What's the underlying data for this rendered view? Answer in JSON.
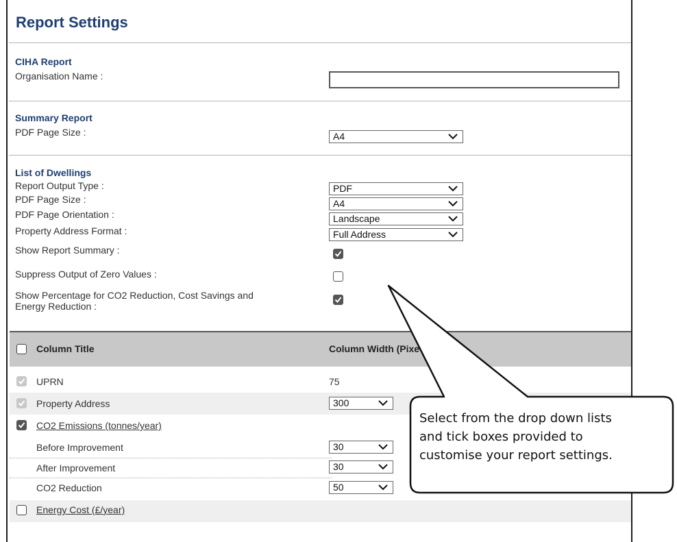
{
  "page_title": "Report Settings",
  "ciha": {
    "heading": "CIHA Report",
    "org_label": "Organisation Name :",
    "org_value": ""
  },
  "summary": {
    "heading": "Summary Report",
    "page_size_label": "PDF Page Size :",
    "page_size_value": "A4"
  },
  "dwellings": {
    "heading": "List of Dwellings",
    "output_type_label": "Report Output Type :",
    "output_type_value": "PDF",
    "page_size_label": "PDF Page Size :",
    "page_size_value": "A4",
    "orientation_label": "PDF Page Orientation :",
    "orientation_value": "Landscape",
    "address_format_label": "Property Address Format :",
    "address_format_value": "Full Address",
    "show_summary_label": "Show Report Summary :",
    "show_summary_checked": true,
    "suppress_zero_label": "Suppress Output of Zero Values :",
    "suppress_zero_checked": false,
    "show_pct_label_1": "Show Percentage for CO2 Reduction, Cost Savings and",
    "show_pct_label_2": "Energy Reduction :",
    "show_pct_checked": true
  },
  "table": {
    "col_title": "Column Title",
    "col_width": "Column Width (Pixe",
    "rows": [
      {
        "title": "UPRN",
        "width": "75"
      },
      {
        "title": "Property Address",
        "width": "300"
      },
      {
        "title": "CO2 Emissions (tonnes/year)",
        "width": ""
      },
      {
        "title": "Before Improvement",
        "width": "30"
      },
      {
        "title": "After Improvement",
        "width": "30"
      },
      {
        "title": "CO2 Reduction",
        "width": "50"
      },
      {
        "title": "Energy Cost (£/year)",
        "width": ""
      }
    ]
  },
  "callout": {
    "line1": "Select from the drop down lists",
    "line2": "and tick boxes provided to",
    "line3": "customise your report settings."
  }
}
